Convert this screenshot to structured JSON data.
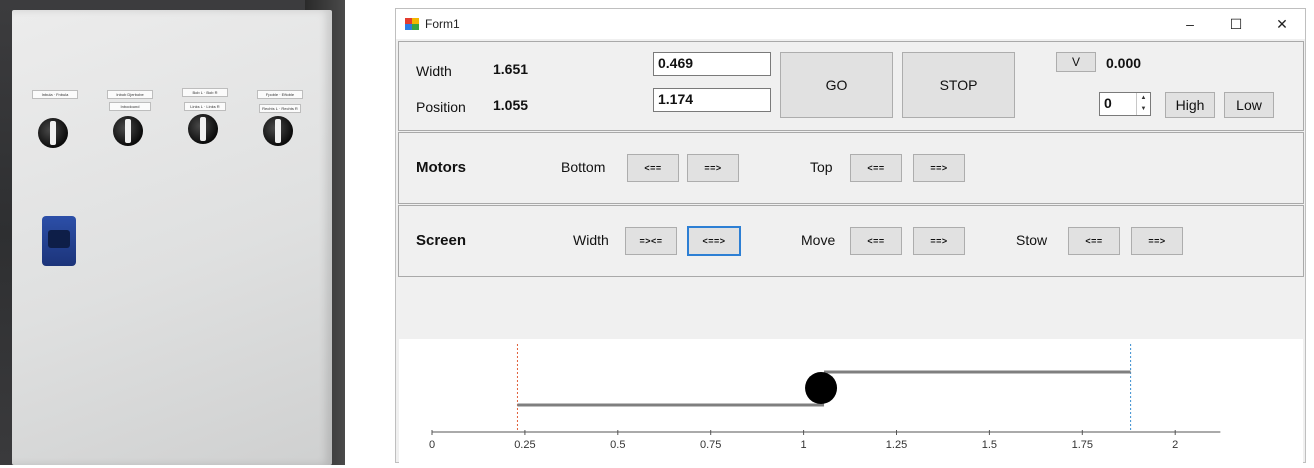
{
  "window": {
    "title": "Form1",
    "controls": {
      "minimize": "–",
      "maximize": "☐",
      "close": "✕"
    }
  },
  "top_panel": {
    "width_label": "Width",
    "width_value": "1.651",
    "position_label": "Position",
    "position_value": "1.055",
    "width_input": "0.469",
    "position_input": "1.174",
    "go_label": "GO",
    "stop_label": "STOP",
    "v_label": "V",
    "v_value": "0.000",
    "spin_value": "0",
    "high_label": "High",
    "low_label": "Low"
  },
  "motors_panel": {
    "title": "Motors",
    "bottom_label": "Bottom",
    "bottom_left": "<==",
    "bottom_right": "==>",
    "top_label": "Top",
    "top_left": "<==",
    "top_right": "==>"
  },
  "screen_panel": {
    "title": "Screen",
    "width_label": "Width",
    "width_narrow": "=><=",
    "width_widen": "<==>",
    "move_label": "Move",
    "move_left": "<==",
    "move_right": "==>",
    "stow_label": "Stow",
    "stow_left": "<==",
    "stow_right": "==>"
  },
  "chart_data": {
    "type": "line",
    "xlim": [
      0,
      2.1
    ],
    "ticks": [
      0,
      0.25,
      0.5,
      0.75,
      1,
      1.25,
      1.5,
      1.75,
      2
    ],
    "tick_labels": [
      "0",
      "0.25",
      "0.5",
      "0.75",
      "1",
      "1.25",
      "1.5",
      "1.75",
      "2"
    ],
    "left_limit": 0.23,
    "right_limit": 1.88,
    "bottom_segment": [
      0.23,
      1.055
    ],
    "top_segment": [
      1.055,
      1.88
    ],
    "marker_position": 1.055,
    "colors": {
      "left_limit": "#e0603a",
      "right_limit": "#3a8fd0",
      "segment": "#7f7f7f",
      "axis": "#555555",
      "marker": "#000000"
    }
  },
  "photo": {
    "switch_labels": [
      "Inbula · Fnbula",
      "Inbob Djerbobe",
      "Bob L · Bob R",
      "Fpoble · Eftoble",
      "Inbodound",
      "Links L · Links R",
      "Rechts L · Rechts R"
    ]
  }
}
